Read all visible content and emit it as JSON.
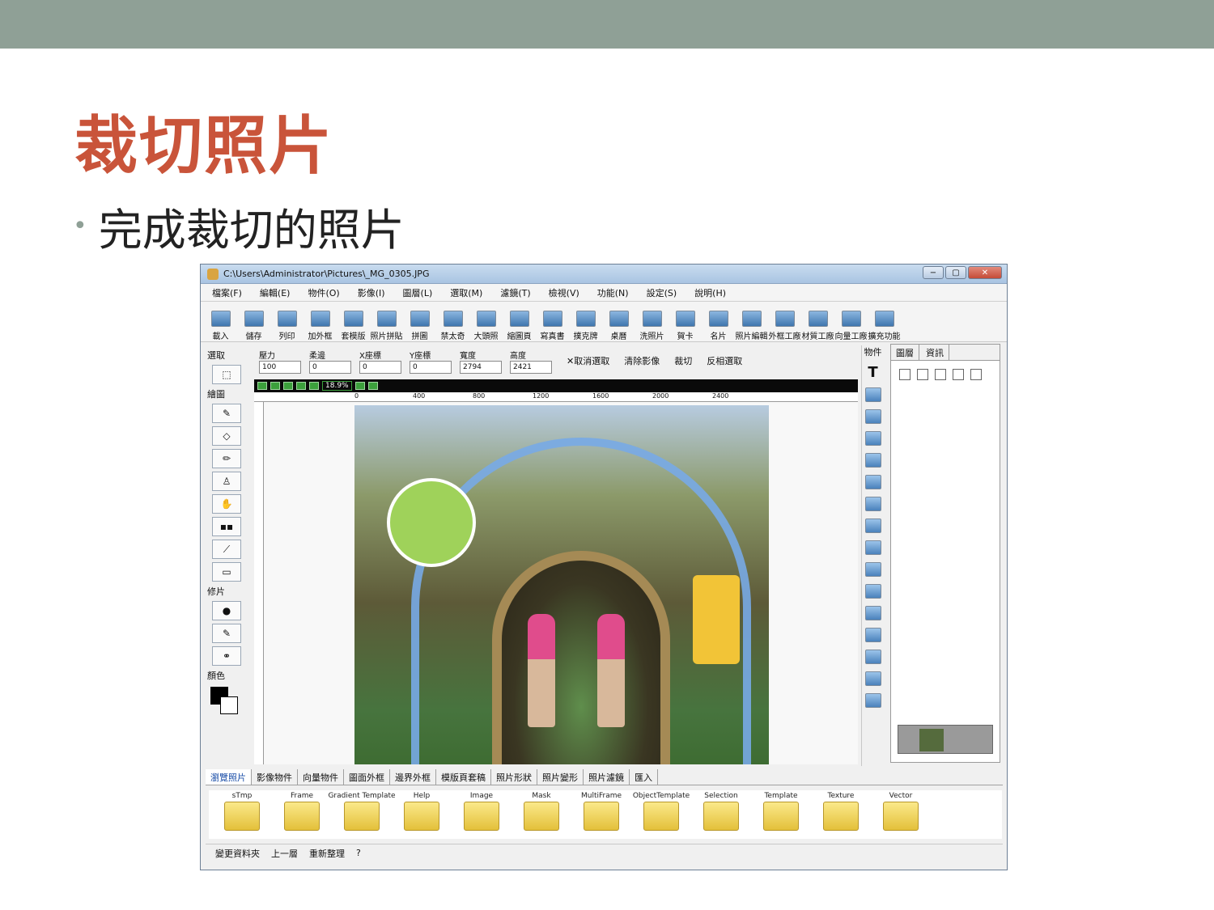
{
  "slide": {
    "title": "裁切照片",
    "bullet": "完成裁切的照片"
  },
  "window": {
    "title": "C:\\Users\\Administrator\\Pictures\\_MG_0305.JPG",
    "controls": [
      "−",
      "▢",
      "✕"
    ]
  },
  "menu": [
    "檔案(F)",
    "編輯(E)",
    "物件(O)",
    "影像(I)",
    "圖層(L)",
    "選取(M)",
    "濾鏡(T)",
    "檢視(V)",
    "功能(N)",
    "設定(S)",
    "說明(H)"
  ],
  "toolbar": [
    "載入",
    "儲存",
    "列印",
    "加外框",
    "套模版",
    "照片拼貼",
    "拼圖",
    "禁太奇",
    "大頭照",
    "縮圖頁",
    "寫真書",
    "撲克牌",
    "桌曆",
    "洗照片",
    "賀卡",
    "名片",
    "照片編輯",
    "外框工廠",
    "材質工廠",
    "向量工廠",
    "擴充功能"
  ],
  "left_panel": {
    "select_label": "選取",
    "draw_label": "繪圖",
    "retouch_label": "修片",
    "color_label": "顏色"
  },
  "options": {
    "fields": [
      {
        "label": "壓力",
        "value": "100"
      },
      {
        "label": "柔邊",
        "value": "0"
      },
      {
        "label": "X座標",
        "value": "0"
      },
      {
        "label": "Y座標",
        "value": "0"
      },
      {
        "label": "寬度",
        "value": "2794"
      },
      {
        "label": "高度",
        "value": "2421"
      }
    ],
    "buttons": [
      "✕取消選取",
      "清除影像",
      "裁切",
      "反相選取"
    ]
  },
  "view": {
    "zoom": "18.9%",
    "ruler_h": [
      "0",
      "400",
      "800",
      "1200",
      "1600",
      "2000",
      "2400"
    ]
  },
  "objects_label": "物件",
  "layers_tabs": [
    "圖層",
    "資訊"
  ],
  "browser_tabs": [
    "瀏覽照片",
    "影像物件",
    "向量物件",
    "圖面外框",
    "邊界外框",
    "模版頁套稿",
    "照片形狀",
    "照片變形",
    "照片濾鏡",
    "匯入"
  ],
  "folders": [
    "sTmp",
    "Frame",
    "Gradient Template",
    "Help",
    "Image",
    "Mask",
    "MultiFrame",
    "ObjectTemplate",
    "Selection",
    "Template",
    "Texture",
    "Vector"
  ],
  "status": [
    "變更資料夾",
    "上一層",
    "重新整理"
  ]
}
